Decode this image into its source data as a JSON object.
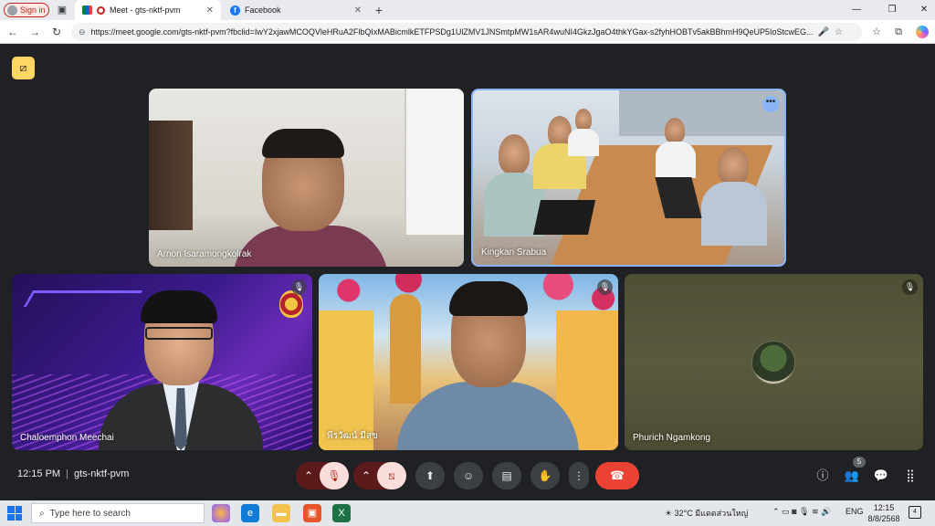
{
  "browser": {
    "signin_label": "Sign in",
    "tabs": [
      {
        "title": "Meet - gts-nktf-pvm",
        "icon": "google-meet-icon",
        "active": true
      },
      {
        "title": "Facebook",
        "icon": "facebook-icon",
        "active": false
      }
    ],
    "url": "https://meet.google.com/gts-nktf-pvm?fbclid=IwY2xjawMCOQVleHRuA2FlbQIxMABicmlkETFPSDg1UlZMV1JNSmtpMW1sAR4wuNI4GkzJgaO4thkYGax-s2fyhHOBTv5akBBhmH9QeUP5IoStcwEG..."
  },
  "meet": {
    "participants": [
      {
        "name": "Arnon Isaramongkolrak",
        "muted": false
      },
      {
        "name": "Kingkan Srabua",
        "muted": false,
        "more_options": "•••"
      },
      {
        "name": "Chaloemphon Meechai",
        "muted": true
      },
      {
        "name": "พีรวัฒน์ มีสุข",
        "muted": true
      },
      {
        "name": "Phurich Ngamkong",
        "muted": true
      }
    ],
    "time": "12:15 PM",
    "meeting_code": "gts-nktf-pvm",
    "people_count": "5",
    "accent_red": "#ea4335",
    "captions_color": "#fdd663"
  },
  "taskbar": {
    "search_placeholder": "Type here to search",
    "weather_temp": "32°C",
    "weather_text": "มีแดดส่วนใหญ่",
    "language": "ENG",
    "clock_time": "12:15",
    "clock_date": "8/8/2568",
    "notification_count": "4"
  }
}
